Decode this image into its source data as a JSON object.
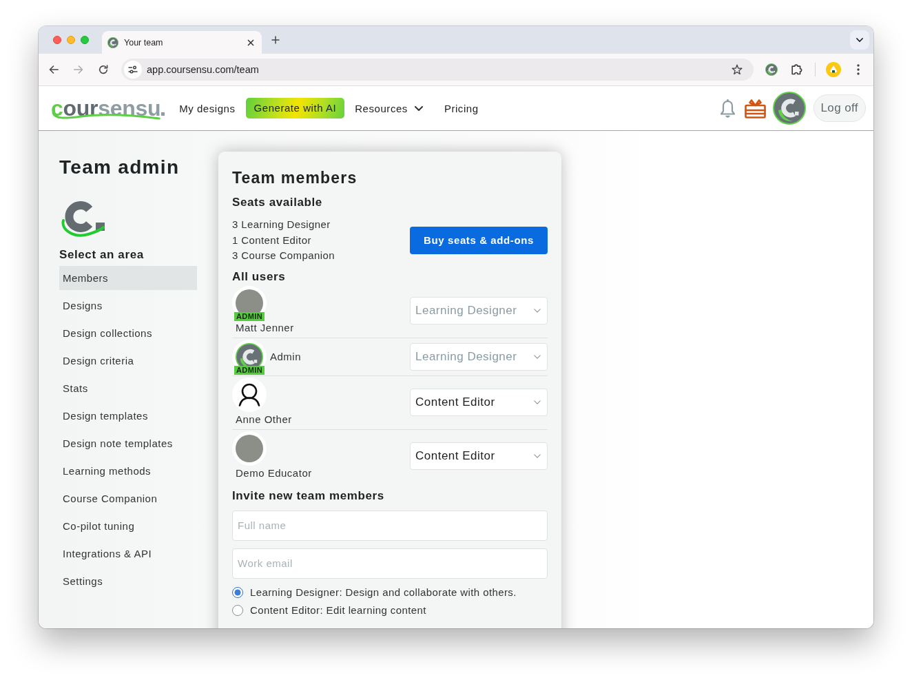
{
  "browser": {
    "tab_title": "Your team",
    "url": "app.coursensu.com/team"
  },
  "header": {
    "logo": [
      "c",
      "our",
      "sensu"
    ],
    "nav": [
      {
        "kind": "link",
        "label": "My designs"
      },
      {
        "kind": "highlight",
        "label": "Generate with AI"
      },
      {
        "kind": "dropdown",
        "label": "Resources"
      },
      {
        "kind": "link",
        "label": "Pricing"
      }
    ],
    "logoff": "Log off"
  },
  "sidebar": {
    "title": "Team admin",
    "subtitle": "Select an area",
    "items": [
      {
        "label": "Members",
        "selected": true
      },
      {
        "label": "Designs",
        "selected": false
      },
      {
        "label": "Design collections",
        "selected": false
      },
      {
        "label": "Design criteria",
        "selected": false
      },
      {
        "label": "Stats",
        "selected": false
      },
      {
        "label": "Design templates",
        "selected": false
      },
      {
        "label": "Design note templates",
        "selected": false
      },
      {
        "label": "Learning methods",
        "selected": false
      },
      {
        "label": "Course Companion",
        "selected": false
      },
      {
        "label": "Co-pilot tuning",
        "selected": false
      },
      {
        "label": "Integrations & API",
        "selected": false
      },
      {
        "label": "Settings",
        "selected": false
      }
    ]
  },
  "panel": {
    "title": "Team members",
    "seats": {
      "heading": "Seats available",
      "lines": [
        "3 Learning Designer",
        "1 Content Editor",
        "3 Course Companion"
      ],
      "button": "Buy seats & add-ons"
    },
    "users": {
      "heading": "All users",
      "rows": [
        {
          "kind": "photo",
          "badge": "ADMIN",
          "name": "Matt Jenner",
          "role": "Learning Designer",
          "disabled": true
        },
        {
          "kind": "logo",
          "badge": "ADMIN",
          "name": "Admin",
          "role": "Learning Designer",
          "disabled": true
        },
        {
          "kind": "generic",
          "name": "Anne Other",
          "role": "Content Editor",
          "disabled": false
        },
        {
          "kind": "photo",
          "name": "Demo Educator",
          "role": "Content Editor",
          "disabled": false
        }
      ]
    },
    "invite": {
      "heading": "Invite new team members",
      "fields": [
        {
          "placeholder": "Full name"
        },
        {
          "placeholder": "Work email"
        }
      ],
      "roles": [
        {
          "label": "Learning Designer: Design and collaborate with others.",
          "selected": true
        },
        {
          "label": "Content Editor: Edit learning content",
          "selected": false
        }
      ]
    }
  }
}
